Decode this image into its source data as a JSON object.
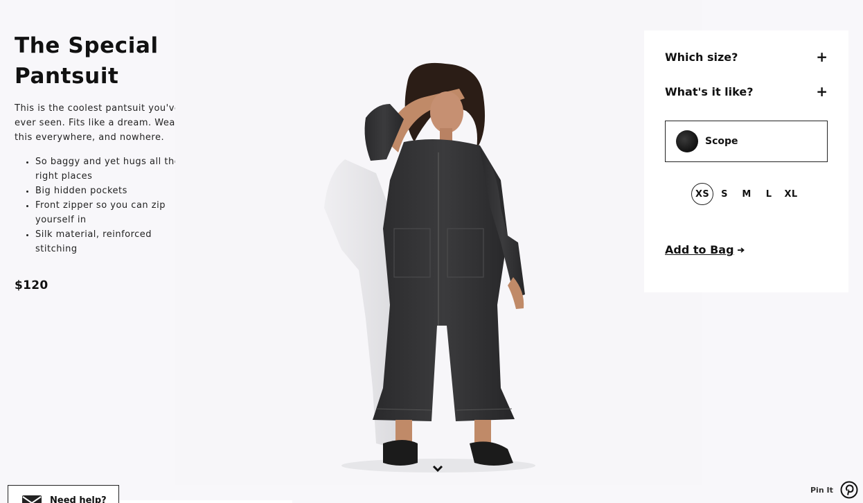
{
  "product": {
    "title_line1": "The Special",
    "title_line2": "Pantsuit",
    "description": "This is the coolest pantsuit you've ever seen. Fits like a dream. Wear this everywhere, and nowhere.",
    "features": [
      "So baggy and yet hugs all the right places",
      "Big hidden pockets",
      "Front zipper so you can zip yourself in",
      "Silk material, reinforced stitching"
    ],
    "price": "$120"
  },
  "panel": {
    "accordion": [
      {
        "label": "Which size?",
        "icon": "plus-icon"
      },
      {
        "label": "What's it like?",
        "icon": "plus-icon"
      }
    ],
    "color": {
      "label": "Scope",
      "swatch_color": "#1a1a1a"
    },
    "sizes": [
      {
        "label": "XS",
        "selected": true
      },
      {
        "label": "S",
        "selected": false
      },
      {
        "label": "M",
        "selected": false
      },
      {
        "label": "L",
        "selected": false
      },
      {
        "label": "XL",
        "selected": false
      }
    ],
    "add_to_bag": "Add to Bag",
    "add_to_bag_icon": "arrow-right-icon"
  },
  "help": {
    "label": "Need help?",
    "icon": "envelope-icon"
  },
  "pin": {
    "label": "Pin It",
    "icon": "pinterest-icon"
  },
  "photo": {
    "icon": "model-in-black-jumpsuit",
    "scroll_icon": "chevron-down-icon"
  },
  "colors": {
    "background": "#f8f7fa",
    "panel": "#ffffff",
    "text": "#111111"
  }
}
